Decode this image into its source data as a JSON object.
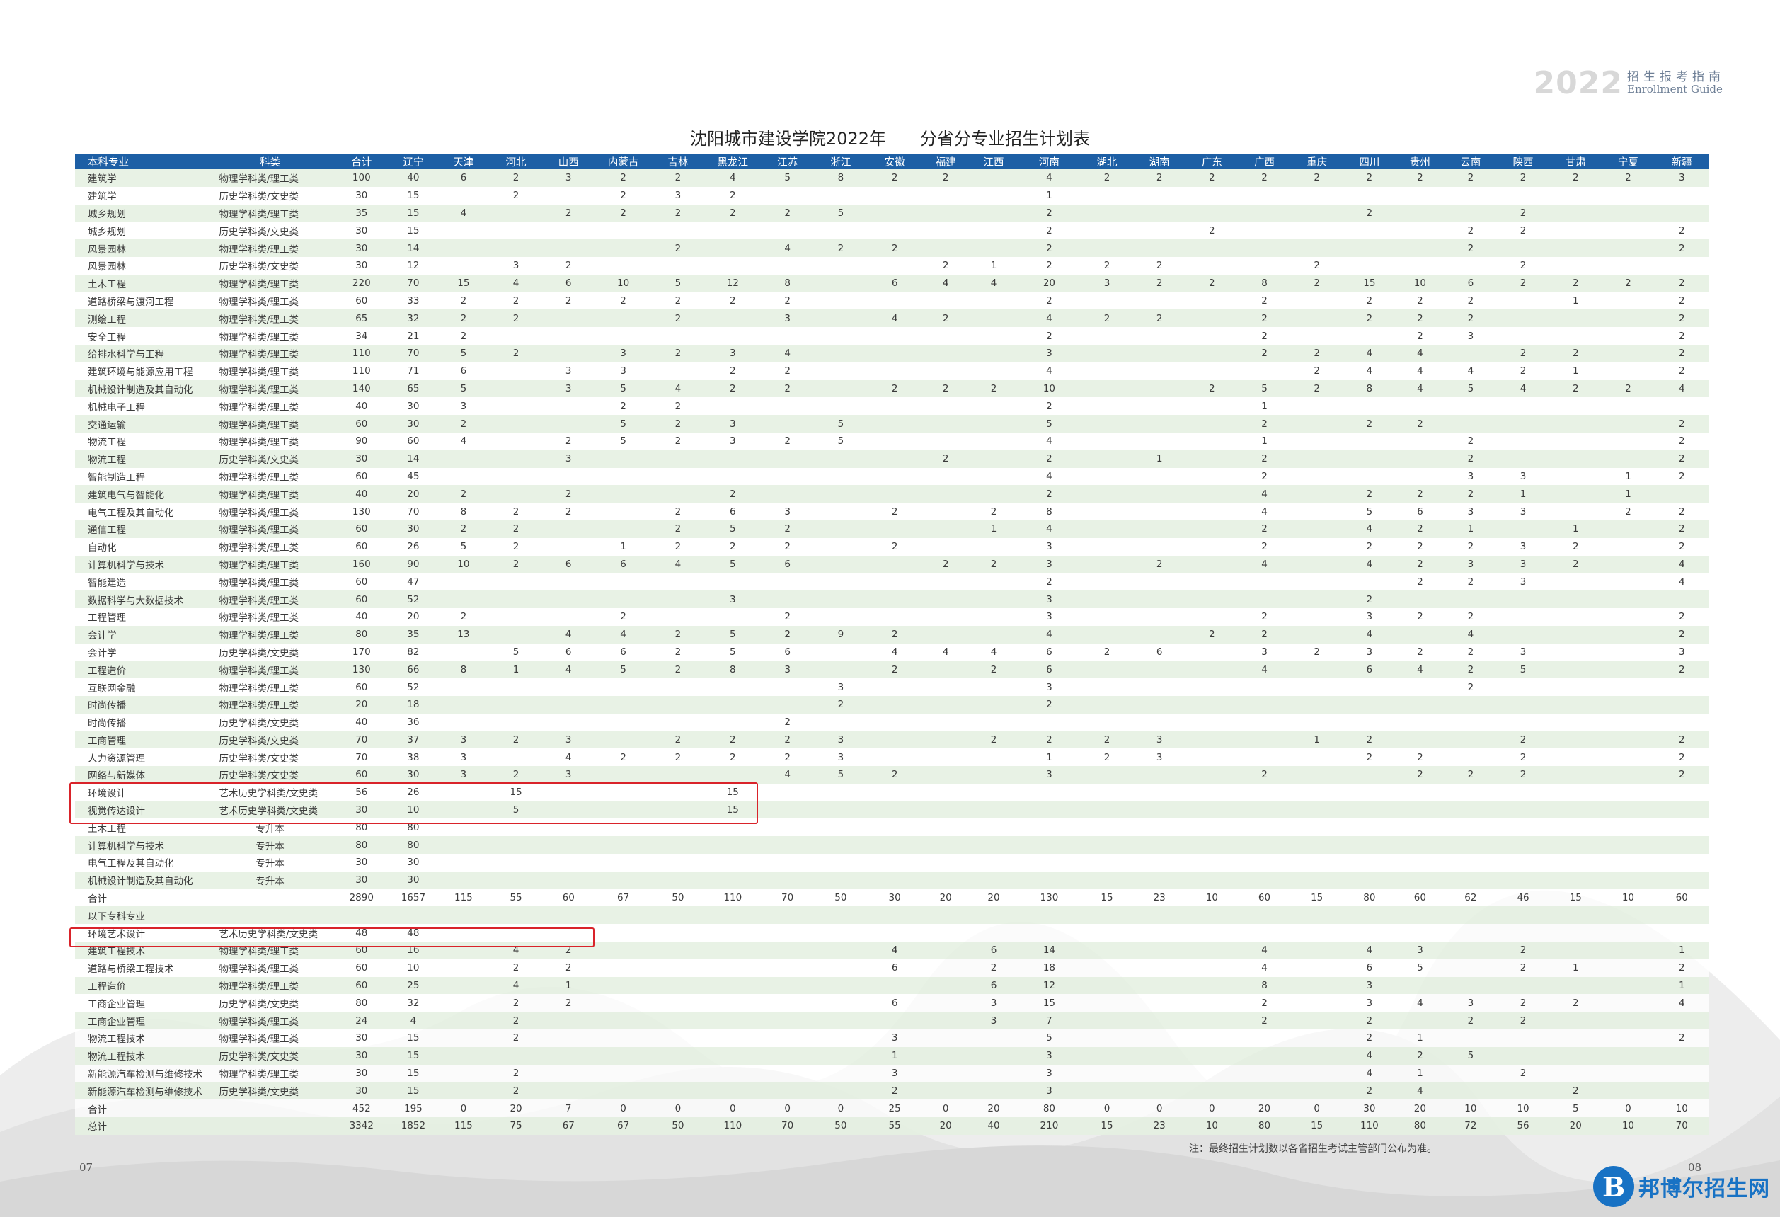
{
  "brand": {
    "year": "2022",
    "title_cn": "招生报考指南",
    "title_en": "Enrollment Guide"
  },
  "title": {
    "part1": "沈阳城市建设学院2022年",
    "part2": "分省分专业招生计划表"
  },
  "columns": [
    "本科专业",
    "科类",
    "合计",
    "辽宁",
    "天津",
    "河北",
    "山西",
    "内蒙古",
    "吉林",
    "黑龙江",
    "江苏",
    "浙江",
    "安徽",
    "福建",
    "江西",
    "河南",
    "湖北",
    "湖南",
    "广东",
    "广西",
    "重庆",
    "四川",
    "贵州",
    "云南",
    "陕西",
    "甘肃",
    "宁夏",
    "新疆"
  ],
  "rows": [
    [
      "建筑学",
      "物理学科类/理工类",
      "100",
      "40",
      "6",
      "2",
      "3",
      "2",
      "2",
      "4",
      "5",
      "8",
      "2",
      "2",
      "",
      "4",
      "2",
      "2",
      "2",
      "2",
      "2",
      "2",
      "2",
      "2",
      "2",
      "2",
      "2",
      "3"
    ],
    [
      "建筑学",
      "历史学科类/文史类",
      "30",
      "15",
      "",
      "2",
      "",
      "2",
      "3",
      "2",
      "",
      "",
      "",
      "",
      "",
      "1",
      "",
      "",
      "",
      "",
      "",
      "",
      "",
      "",
      "",
      "",
      "",
      ""
    ],
    [
      "城乡规划",
      "物理学科类/理工类",
      "35",
      "15",
      "4",
      "",
      "2",
      "2",
      "2",
      "2",
      "2",
      "5",
      "",
      "",
      "",
      "2",
      "",
      "",
      "",
      "",
      "",
      "2",
      "",
      "",
      "2",
      "",
      "",
      ""
    ],
    [
      "城乡规划",
      "历史学科类/文史类",
      "30",
      "15",
      "",
      "",
      "",
      "",
      "",
      "",
      "",
      "",
      "",
      "",
      "",
      "2",
      "",
      "",
      "2",
      "",
      "",
      "",
      "",
      "2",
      "2",
      "",
      "",
      "2"
    ],
    [
      "风景园林",
      "物理学科类/理工类",
      "30",
      "14",
      "",
      "",
      "",
      "",
      "2",
      "",
      "4",
      "2",
      "2",
      "",
      "",
      "2",
      "",
      "",
      "",
      "",
      "",
      "",
      "",
      "2",
      "",
      "",
      "",
      "2"
    ],
    [
      "风景园林",
      "历史学科类/文史类",
      "30",
      "12",
      "",
      "3",
      "2",
      "",
      "",
      "",
      "",
      "",
      "",
      "2",
      "1",
      "2",
      "2",
      "2",
      "",
      "",
      "2",
      "",
      "",
      "",
      "2",
      "",
      "",
      ""
    ],
    [
      "土木工程",
      "物理学科类/理工类",
      "220",
      "70",
      "15",
      "4",
      "6",
      "10",
      "5",
      "12",
      "8",
      "",
      "6",
      "4",
      "4",
      "20",
      "3",
      "2",
      "2",
      "8",
      "2",
      "15",
      "10",
      "6",
      "2",
      "2",
      "2",
      "2"
    ],
    [
      "道路桥梁与渡河工程",
      "物理学科类/理工类",
      "60",
      "33",
      "2",
      "2",
      "2",
      "2",
      "2",
      "2",
      "2",
      "",
      "",
      "",
      "",
      "2",
      "",
      "",
      "",
      "2",
      "",
      "2",
      "2",
      "2",
      "",
      "1",
      "",
      "2"
    ],
    [
      "测绘工程",
      "物理学科类/理工类",
      "65",
      "32",
      "2",
      "2",
      "",
      "",
      "2",
      "",
      "3",
      "",
      "4",
      "2",
      "",
      "4",
      "2",
      "2",
      "",
      "2",
      "",
      "2",
      "2",
      "2",
      "",
      "",
      "",
      "2"
    ],
    [
      "安全工程",
      "物理学科类/理工类",
      "34",
      "21",
      "2",
      "",
      "",
      "",
      "",
      "",
      "",
      "",
      "",
      "",
      "",
      "2",
      "",
      "",
      "",
      "2",
      "",
      "",
      "2",
      "3",
      "",
      "",
      "",
      "2"
    ],
    [
      "给排水科学与工程",
      "物理学科类/理工类",
      "110",
      "70",
      "5",
      "2",
      "",
      "3",
      "2",
      "3",
      "4",
      "",
      "",
      "",
      "",
      "3",
      "",
      "",
      "",
      "2",
      "2",
      "4",
      "4",
      "",
      "2",
      "2",
      "",
      "2"
    ],
    [
      "建筑环境与能源应用工程",
      "物理学科类/理工类",
      "110",
      "71",
      "6",
      "",
      "3",
      "3",
      "",
      "2",
      "2",
      "",
      "",
      "",
      "",
      "4",
      "",
      "",
      "",
      "",
      "2",
      "4",
      "4",
      "4",
      "2",
      "1",
      "",
      "2"
    ],
    [
      "机械设计制造及其自动化",
      "物理学科类/理工类",
      "140",
      "65",
      "5",
      "",
      "3",
      "5",
      "4",
      "2",
      "2",
      "",
      "2",
      "2",
      "2",
      "10",
      "",
      "",
      "2",
      "5",
      "2",
      "8",
      "4",
      "5",
      "4",
      "2",
      "2",
      "4"
    ],
    [
      "机械电子工程",
      "物理学科类/理工类",
      "40",
      "30",
      "3",
      "",
      "",
      "2",
      "2",
      "",
      "",
      "",
      "",
      "",
      "",
      "2",
      "",
      "",
      "",
      "1",
      "",
      "",
      "",
      "",
      "",
      "",
      "",
      ""
    ],
    [
      "交通运输",
      "物理学科类/理工类",
      "60",
      "30",
      "2",
      "",
      "",
      "5",
      "2",
      "3",
      "",
      "5",
      "",
      "",
      "",
      "5",
      "",
      "",
      "",
      "2",
      "",
      "2",
      "2",
      "",
      "",
      "",
      "",
      "2"
    ],
    [
      "物流工程",
      "物理学科类/理工类",
      "90",
      "60",
      "4",
      "",
      "2",
      "5",
      "2",
      "3",
      "2",
      "5",
      "",
      "",
      "",
      "4",
      "",
      "",
      "",
      "1",
      "",
      "",
      "",
      "2",
      "",
      "",
      "",
      "2"
    ],
    [
      "物流工程",
      "历史学科类/文史类",
      "30",
      "14",
      "",
      "",
      "3",
      "",
      "",
      "",
      "",
      "",
      "",
      "2",
      "",
      "2",
      "",
      "1",
      "",
      "2",
      "",
      "",
      "",
      "2",
      "",
      "",
      "",
      "2"
    ],
    [
      "智能制造工程",
      "物理学科类/理工类",
      "60",
      "45",
      "",
      "",
      "",
      "",
      "",
      "",
      "",
      "",
      "",
      "",
      "",
      "4",
      "",
      "",
      "",
      "2",
      "",
      "",
      "",
      "3",
      "3",
      "",
      "1",
      "2"
    ],
    [
      "建筑电气与智能化",
      "物理学科类/理工类",
      "40",
      "20",
      "2",
      "",
      "2",
      "",
      "",
      "2",
      "",
      "",
      "",
      "",
      "",
      "2",
      "",
      "",
      "",
      "4",
      "",
      "2",
      "2",
      "2",
      "1",
      "",
      "1",
      ""
    ],
    [
      "电气工程及其自动化",
      "物理学科类/理工类",
      "130",
      "70",
      "8",
      "2",
      "2",
      "",
      "2",
      "6",
      "3",
      "",
      "2",
      "",
      "2",
      "8",
      "",
      "",
      "",
      "4",
      "",
      "5",
      "6",
      "3",
      "3",
      "",
      "2",
      "2"
    ],
    [
      "通信工程",
      "物理学科类/理工类",
      "60",
      "30",
      "2",
      "2",
      "",
      "",
      "2",
      "5",
      "2",
      "",
      "",
      "",
      "1",
      "4",
      "",
      "",
      "",
      "2",
      "",
      "4",
      "2",
      "1",
      "",
      "1",
      "",
      "2"
    ],
    [
      "自动化",
      "物理学科类/理工类",
      "60",
      "26",
      "5",
      "2",
      "",
      "1",
      "2",
      "2",
      "2",
      "",
      "2",
      "",
      "",
      "3",
      "",
      "",
      "",
      "2",
      "",
      "2",
      "2",
      "2",
      "3",
      "2",
      "",
      "2"
    ],
    [
      "计算机科学与技术",
      "物理学科类/理工类",
      "160",
      "90",
      "10",
      "2",
      "6",
      "6",
      "4",
      "5",
      "6",
      "",
      "",
      "2",
      "2",
      "3",
      "",
      "2",
      "",
      "4",
      "",
      "4",
      "2",
      "3",
      "3",
      "2",
      "",
      "4"
    ],
    [
      "智能建造",
      "物理学科类/理工类",
      "60",
      "47",
      "",
      "",
      "",
      "",
      "",
      "",
      "",
      "",
      "",
      "",
      "",
      "2",
      "",
      "",
      "",
      "",
      "",
      "",
      "2",
      "2",
      "3",
      "",
      "",
      "4"
    ],
    [
      "数据科学与大数据技术",
      "物理学科类/理工类",
      "60",
      "52",
      "",
      "",
      "",
      "",
      "",
      "3",
      "",
      "",
      "",
      "",
      "",
      "3",
      "",
      "",
      "",
      "",
      "",
      "2",
      "",
      "",
      "",
      "",
      "",
      ""
    ],
    [
      "工程管理",
      "物理学科类/理工类",
      "40",
      "20",
      "2",
      "",
      "",
      "2",
      "",
      "",
      "2",
      "",
      "",
      "",
      "",
      "3",
      "",
      "",
      "",
      "2",
      "",
      "3",
      "2",
      "2",
      "",
      "",
      "",
      "2"
    ],
    [
      "会计学",
      "物理学科类/理工类",
      "80",
      "35",
      "13",
      "",
      "4",
      "4",
      "2",
      "5",
      "2",
      "9",
      "2",
      "",
      "",
      "4",
      "",
      "",
      "2",
      "2",
      "",
      "4",
      "",
      "4",
      "",
      "",
      "",
      "2"
    ],
    [
      "会计学",
      "历史学科类/文史类",
      "170",
      "82",
      "",
      "5",
      "6",
      "6",
      "2",
      "5",
      "6",
      "",
      "4",
      "4",
      "4",
      "6",
      "2",
      "6",
      "",
      "3",
      "2",
      "3",
      "2",
      "2",
      "3",
      "",
      "",
      "3"
    ],
    [
      "工程造价",
      "物理学科类/理工类",
      "130",
      "66",
      "8",
      "1",
      "4",
      "5",
      "2",
      "8",
      "3",
      "",
      "2",
      "",
      "2",
      "6",
      "",
      "",
      "",
      "4",
      "",
      "6",
      "4",
      "2",
      "5",
      "",
      "",
      "2"
    ],
    [
      "互联网金融",
      "物理学科类/理工类",
      "60",
      "52",
      "",
      "",
      "",
      "",
      "",
      "",
      "",
      "3",
      "",
      "",
      "",
      "3",
      "",
      "",
      "",
      "",
      "",
      "",
      "",
      "2",
      "",
      "",
      "",
      ""
    ],
    [
      "时尚传播",
      "物理学科类/理工类",
      "20",
      "18",
      "",
      "",
      "",
      "",
      "",
      "",
      "",
      "2",
      "",
      "",
      "",
      "2",
      "",
      "",
      "",
      "",
      "",
      "",
      "",
      "",
      "",
      "",
      "",
      ""
    ],
    [
      "时尚传播",
      "历史学科类/文史类",
      "40",
      "36",
      "",
      "",
      "",
      "",
      "",
      "",
      "2",
      "",
      "",
      "",
      "",
      "",
      "",
      "",
      "",
      "",
      "",
      "",
      "",
      "",
      "",
      "",
      "",
      ""
    ],
    [
      "工商管理",
      "历史学科类/文史类",
      "70",
      "37",
      "3",
      "2",
      "3",
      "",
      "2",
      "2",
      "2",
      "3",
      "",
      "",
      "2",
      "2",
      "2",
      "3",
      "",
      "",
      "1",
      "2",
      "",
      "",
      "2",
      "",
      "",
      "2"
    ],
    [
      "人力资源管理",
      "历史学科类/文史类",
      "70",
      "38",
      "3",
      "",
      "4",
      "2",
      "2",
      "2",
      "2",
      "3",
      "",
      "",
      "",
      "1",
      "2",
      "3",
      "",
      "",
      "",
      "2",
      "2",
      "",
      "2",
      "",
      "",
      "2"
    ],
    [
      "网络与新媒体",
      "历史学科类/文史类",
      "60",
      "30",
      "3",
      "2",
      "3",
      "",
      "",
      "",
      "4",
      "5",
      "2",
      "",
      "",
      "3",
      "",
      "",
      "",
      "2",
      "",
      "",
      "2",
      "2",
      "2",
      "",
      "",
      "2"
    ],
    [
      "环境设计",
      "艺术历史学科类/文史类",
      "56",
      "26",
      "",
      "15",
      "",
      "",
      "",
      "15",
      "",
      "",
      "",
      "",
      "",
      "",
      "",
      "",
      "",
      "",
      "",
      "",
      "",
      "",
      "",
      "",
      "",
      ""
    ],
    [
      "视觉传达设计",
      "艺术历史学科类/文史类",
      "30",
      "10",
      "",
      "5",
      "",
      "",
      "",
      "15",
      "",
      "",
      "",
      "",
      "",
      "",
      "",
      "",
      "",
      "",
      "",
      "",
      "",
      "",
      "",
      "",
      "",
      ""
    ],
    [
      "土木工程",
      "专升本",
      "80",
      "80",
      "",
      "",
      "",
      "",
      "",
      "",
      "",
      "",
      "",
      "",
      "",
      "",
      "",
      "",
      "",
      "",
      "",
      "",
      "",
      "",
      "",
      "",
      "",
      ""
    ],
    [
      "计算机科学与技术",
      "专升本",
      "80",
      "80",
      "",
      "",
      "",
      "",
      "",
      "",
      "",
      "",
      "",
      "",
      "",
      "",
      "",
      "",
      "",
      "",
      "",
      "",
      "",
      "",
      "",
      "",
      "",
      ""
    ],
    [
      "电气工程及其自动化",
      "专升本",
      "30",
      "30",
      "",
      "",
      "",
      "",
      "",
      "",
      "",
      "",
      "",
      "",
      "",
      "",
      "",
      "",
      "",
      "",
      "",
      "",
      "",
      "",
      "",
      "",
      "",
      ""
    ],
    [
      "机械设计制造及其自动化",
      "专升本",
      "30",
      "30",
      "",
      "",
      "",
      "",
      "",
      "",
      "",
      "",
      "",
      "",
      "",
      "",
      "",
      "",
      "",
      "",
      "",
      "",
      "",
      "",
      "",
      "",
      "",
      ""
    ],
    [
      "合计",
      "",
      "2890",
      "1657",
      "115",
      "55",
      "60",
      "67",
      "50",
      "110",
      "70",
      "50",
      "30",
      "20",
      "20",
      "130",
      "15",
      "23",
      "10",
      "60",
      "15",
      "80",
      "60",
      "62",
      "46",
      "15",
      "10",
      "60"
    ],
    [
      "以下专科专业",
      "",
      "",
      "",
      "",
      "",
      "",
      "",
      "",
      "",
      "",
      "",
      "",
      "",
      "",
      "",
      "",
      "",
      "",
      "",
      "",
      "",
      "",
      "",
      "",
      "",
      "",
      ""
    ],
    [
      "环境艺术设计",
      "艺术历史学科类/文史类",
      "48",
      "48",
      "",
      "",
      "",
      "",
      "",
      "",
      "",
      "",
      "",
      "",
      "",
      "",
      "",
      "",
      "",
      "",
      "",
      "",
      "",
      "",
      "",
      "",
      "",
      ""
    ],
    [
      "建筑工程技术",
      "物理学科类/理工类",
      "60",
      "16",
      "",
      "4",
      "2",
      "",
      "",
      "",
      "",
      "",
      "4",
      "",
      "6",
      "14",
      "",
      "",
      "",
      "4",
      "",
      "4",
      "3",
      "",
      "2",
      "",
      "",
      "1"
    ],
    [
      "道路与桥梁工程技术",
      "物理学科类/理工类",
      "60",
      "10",
      "",
      "2",
      "2",
      "",
      "",
      "",
      "",
      "",
      "6",
      "",
      "2",
      "18",
      "",
      "",
      "",
      "4",
      "",
      "6",
      "5",
      "",
      "2",
      "1",
      "",
      "2"
    ],
    [
      "工程造价",
      "物理学科类/理工类",
      "60",
      "25",
      "",
      "4",
      "1",
      "",
      "",
      "",
      "",
      "",
      "",
      "",
      "6",
      "12",
      "",
      "",
      "",
      "8",
      "",
      "3",
      "",
      "",
      "",
      "",
      "",
      "1"
    ],
    [
      "工商企业管理",
      "历史学科类/文史类",
      "80",
      "32",
      "",
      "2",
      "2",
      "",
      "",
      "",
      "",
      "",
      "6",
      "",
      "3",
      "15",
      "",
      "",
      "",
      "2",
      "",
      "3",
      "4",
      "3",
      "2",
      "2",
      "",
      "4"
    ],
    [
      "工商企业管理",
      "物理学科类/理工类",
      "24",
      "4",
      "",
      "2",
      "",
      "",
      "",
      "",
      "",
      "",
      "",
      "",
      "3",
      "7",
      "",
      "",
      "",
      "2",
      "",
      "2",
      "",
      "2",
      "2",
      "",
      "",
      ""
    ],
    [
      "物流工程技术",
      "物理学科类/理工类",
      "30",
      "15",
      "",
      "2",
      "",
      "",
      "",
      "",
      "",
      "",
      "3",
      "",
      "",
      "5",
      "",
      "",
      "",
      "",
      "",
      "2",
      "1",
      "",
      "",
      "",
      "",
      "2"
    ],
    [
      "物流工程技术",
      "历史学科类/文史类",
      "30",
      "15",
      "",
      "",
      "",
      "",
      "",
      "",
      "",
      "",
      "1",
      "",
      "",
      "3",
      "",
      "",
      "",
      "",
      "",
      "4",
      "2",
      "5",
      "",
      "",
      "",
      ""
    ],
    [
      "新能源汽车检测与维修技术",
      "物理学科类/理工类",
      "30",
      "15",
      "",
      "2",
      "",
      "",
      "",
      "",
      "",
      "",
      "3",
      "",
      "",
      "3",
      "",
      "",
      "",
      "",
      "",
      "4",
      "1",
      "",
      "2",
      "",
      "",
      ""
    ],
    [
      "新能源汽车检测与维修技术",
      "历史学科类/文史类",
      "30",
      "15",
      "",
      "2",
      "",
      "",
      "",
      "",
      "",
      "",
      "2",
      "",
      "",
      "3",
      "",
      "",
      "",
      "",
      "",
      "2",
      "4",
      "",
      "",
      "2",
      "",
      ""
    ],
    [
      "合计",
      "",
      "452",
      "195",
      "0",
      "20",
      "7",
      "0",
      "0",
      "0",
      "0",
      "0",
      "25",
      "0",
      "20",
      "80",
      "0",
      "0",
      "0",
      "20",
      "0",
      "30",
      "20",
      "10",
      "10",
      "5",
      "0",
      "10"
    ],
    [
      "总计",
      "",
      "3342",
      "1852",
      "115",
      "75",
      "67",
      "67",
      "50",
      "110",
      "70",
      "50",
      "55",
      "20",
      "40",
      "210",
      "15",
      "23",
      "10",
      "80",
      "15",
      "110",
      "80",
      "72",
      "56",
      "20",
      "10",
      "70"
    ]
  ],
  "note": "注：最终招生计划数以各省招生考试主管部门公布为准。",
  "page_left": "07",
  "page_right": "08",
  "watermark": {
    "logo": "B",
    "text": "邦博尔招生网"
  }
}
